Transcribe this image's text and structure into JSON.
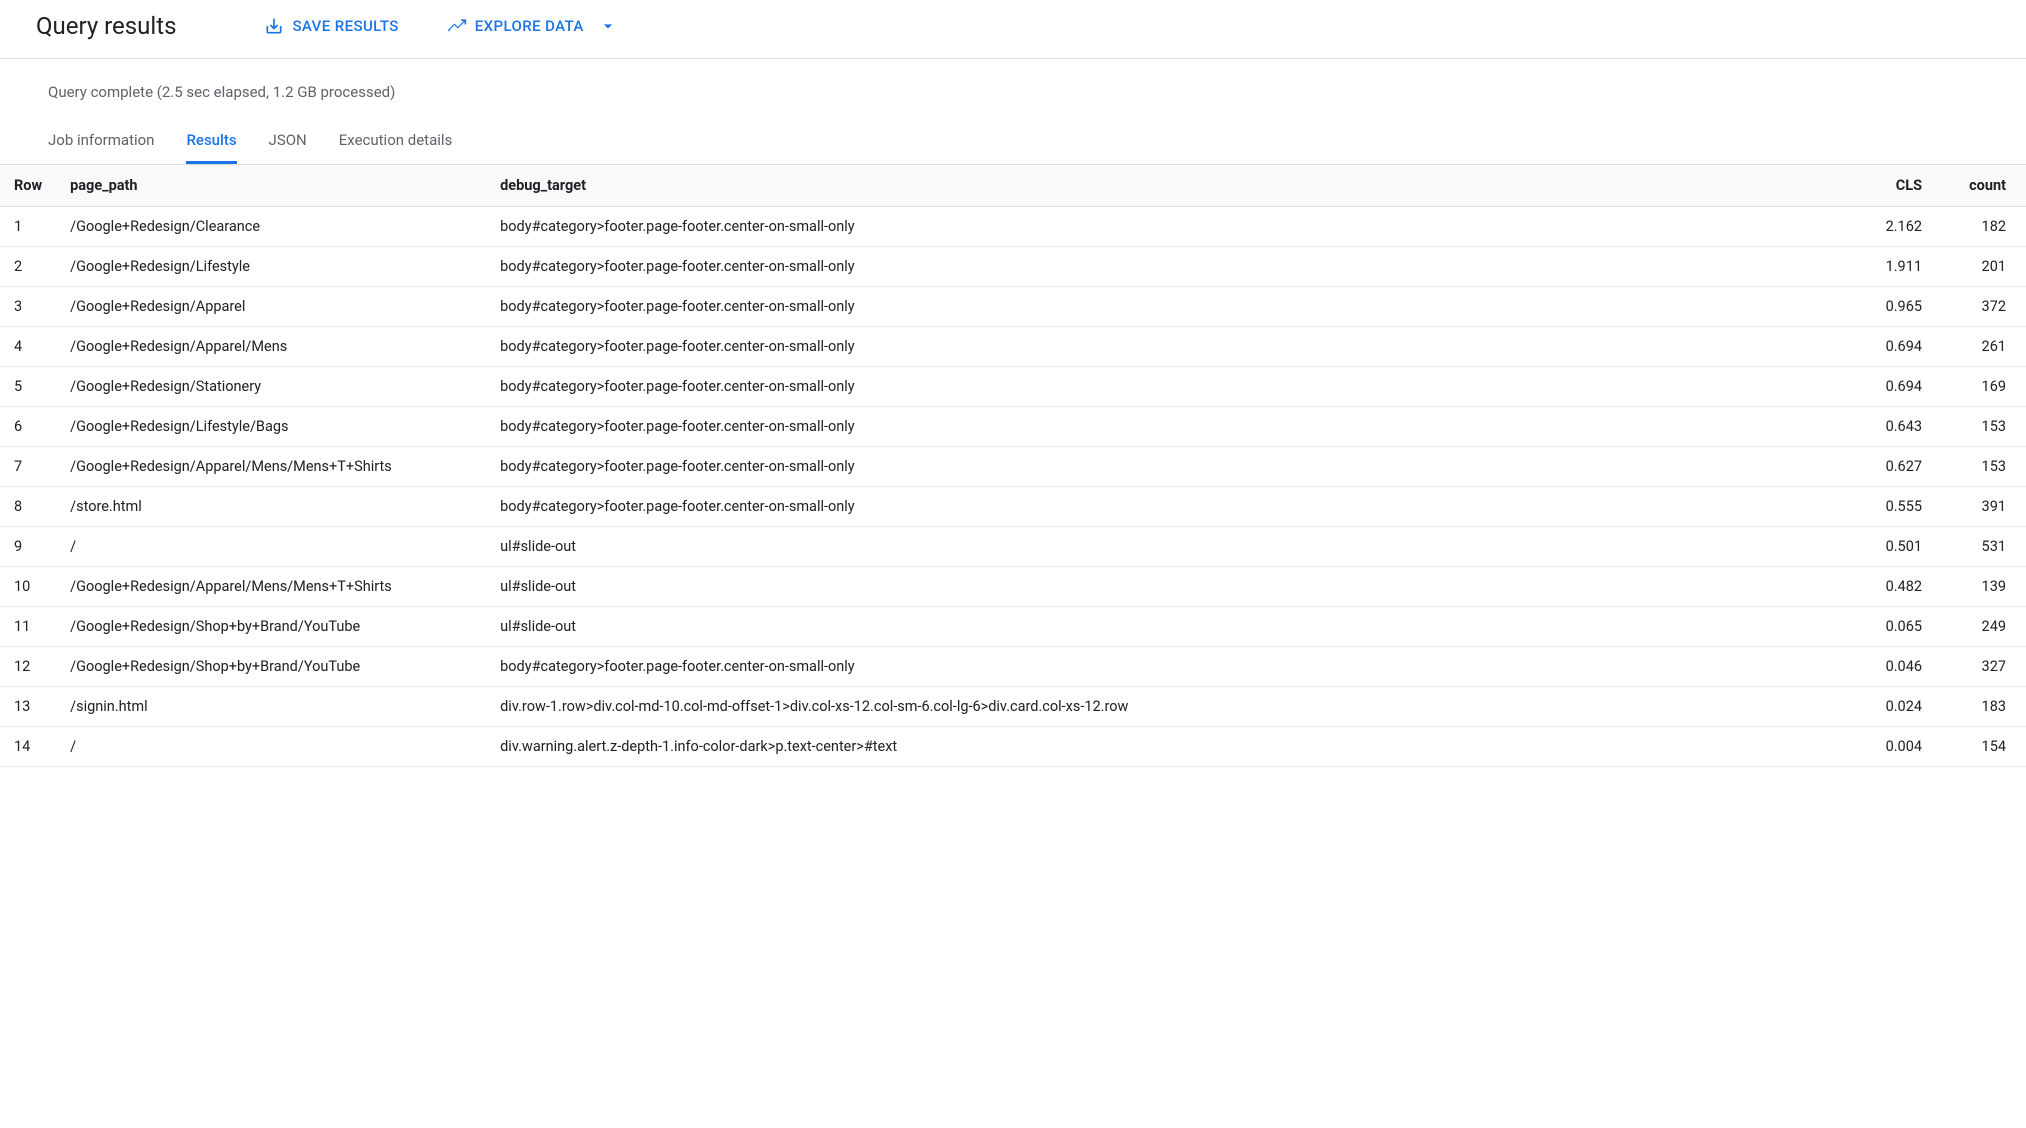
{
  "header": {
    "title": "Query results",
    "save_label": "SAVE RESULTS",
    "explore_label": "EXPLORE DATA"
  },
  "status": "Query complete (2.5 sec elapsed, 1.2 GB processed)",
  "tabs": {
    "job_info": "Job information",
    "results": "Results",
    "json": "JSON",
    "exec": "Execution details"
  },
  "columns": {
    "row": "Row",
    "page_path": "page_path",
    "debug_target": "debug_target",
    "cls": "CLS",
    "count": "count"
  },
  "rows": [
    {
      "n": "1",
      "page_path": "/Google+Redesign/Clearance",
      "debug_target": "body#category>footer.page-footer.center-on-small-only",
      "cls": "2.162",
      "count": "182"
    },
    {
      "n": "2",
      "page_path": "/Google+Redesign/Lifestyle",
      "debug_target": "body#category>footer.page-footer.center-on-small-only",
      "cls": "1.911",
      "count": "201"
    },
    {
      "n": "3",
      "page_path": "/Google+Redesign/Apparel",
      "debug_target": "body#category>footer.page-footer.center-on-small-only",
      "cls": "0.965",
      "count": "372"
    },
    {
      "n": "4",
      "page_path": "/Google+Redesign/Apparel/Mens",
      "debug_target": "body#category>footer.page-footer.center-on-small-only",
      "cls": "0.694",
      "count": "261"
    },
    {
      "n": "5",
      "page_path": "/Google+Redesign/Stationery",
      "debug_target": "body#category>footer.page-footer.center-on-small-only",
      "cls": "0.694",
      "count": "169"
    },
    {
      "n": "6",
      "page_path": "/Google+Redesign/Lifestyle/Bags",
      "debug_target": "body#category>footer.page-footer.center-on-small-only",
      "cls": "0.643",
      "count": "153"
    },
    {
      "n": "7",
      "page_path": "/Google+Redesign/Apparel/Mens/Mens+T+Shirts",
      "debug_target": "body#category>footer.page-footer.center-on-small-only",
      "cls": "0.627",
      "count": "153"
    },
    {
      "n": "8",
      "page_path": "/store.html",
      "debug_target": "body#category>footer.page-footer.center-on-small-only",
      "cls": "0.555",
      "count": "391"
    },
    {
      "n": "9",
      "page_path": "/",
      "debug_target": "ul#slide-out",
      "cls": "0.501",
      "count": "531"
    },
    {
      "n": "10",
      "page_path": "/Google+Redesign/Apparel/Mens/Mens+T+Shirts",
      "debug_target": "ul#slide-out",
      "cls": "0.482",
      "count": "139"
    },
    {
      "n": "11",
      "page_path": "/Google+Redesign/Shop+by+Brand/YouTube",
      "debug_target": "ul#slide-out",
      "cls": "0.065",
      "count": "249"
    },
    {
      "n": "12",
      "page_path": "/Google+Redesign/Shop+by+Brand/YouTube",
      "debug_target": "body#category>footer.page-footer.center-on-small-only",
      "cls": "0.046",
      "count": "327"
    },
    {
      "n": "13",
      "page_path": "/signin.html",
      "debug_target": "div.row-1.row>div.col-md-10.col-md-offset-1>div.col-xs-12.col-sm-6.col-lg-6>div.card.col-xs-12.row",
      "cls": "0.024",
      "count": "183"
    },
    {
      "n": "14",
      "page_path": "/",
      "debug_target": "div.warning.alert.z-depth-1.info-color-dark>p.text-center>#text",
      "cls": "0.004",
      "count": "154"
    }
  ]
}
